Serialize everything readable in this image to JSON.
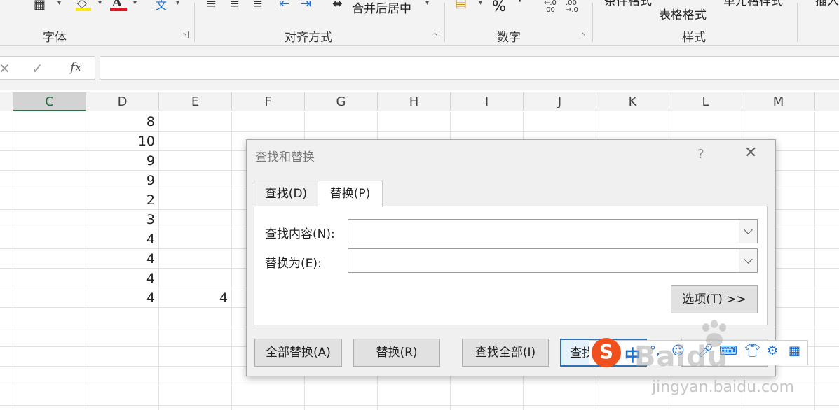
{
  "ribbon": {
    "groups": [
      {
        "label": "字体"
      },
      {
        "label": "对齐方式"
      },
      {
        "label": "数字"
      },
      {
        "label": "样式"
      }
    ],
    "merge_center_label": "合并后居中",
    "percent_symbol": "%",
    "comma_symbol": "'",
    "increase_decimal": ".00→.0",
    "decrease_decimal": ".00→.0",
    "format_as_table_label": "表格格式",
    "cond_format_label": "条件格式",
    "cell_style_label": "单元格样式",
    "insert_label": "插入"
  },
  "formula_bar": {
    "cancel": "✕",
    "enter": "✓",
    "fx": "fx",
    "value": ""
  },
  "grid": {
    "columns": [
      "C",
      "D",
      "E",
      "F",
      "G",
      "H",
      "I",
      "J",
      "K",
      "L",
      "M"
    ],
    "active_column": "C",
    "column_d_values": [
      "8",
      "10",
      "9",
      "9",
      "2",
      "3",
      "4",
      "4",
      "4",
      "4"
    ],
    "column_e_values": [
      "",
      "",
      "",
      "",
      "",
      "",
      "",
      "",
      "",
      "4"
    ]
  },
  "dialog": {
    "title": "查找和替换",
    "help": "?",
    "close": "✕",
    "tabs": [
      {
        "label": "查找(D)",
        "active": false
      },
      {
        "label": "替换(P)",
        "active": true
      }
    ],
    "find_label": "查找内容(N):",
    "find_value": "",
    "replace_label": "替换为(E):",
    "replace_value": "",
    "options_button": "选项(T) >>",
    "buttons": {
      "replace_all": "全部替换(A)",
      "replace": "替换(R)",
      "find_all": "查找全部(I)",
      "find_next": "查找"
    }
  },
  "ime": {
    "logo": "S",
    "mode": "中"
  },
  "watermark": {
    "main": "Baidu",
    "sub": "jingyan.baidu.com"
  },
  "colors": {
    "accent_green": "#217346",
    "font_color_red": "#e81123",
    "highlight_yellow": "#ffeb00",
    "primary_blue": "#2f6fb6",
    "ime_orange": "#f0501e"
  }
}
